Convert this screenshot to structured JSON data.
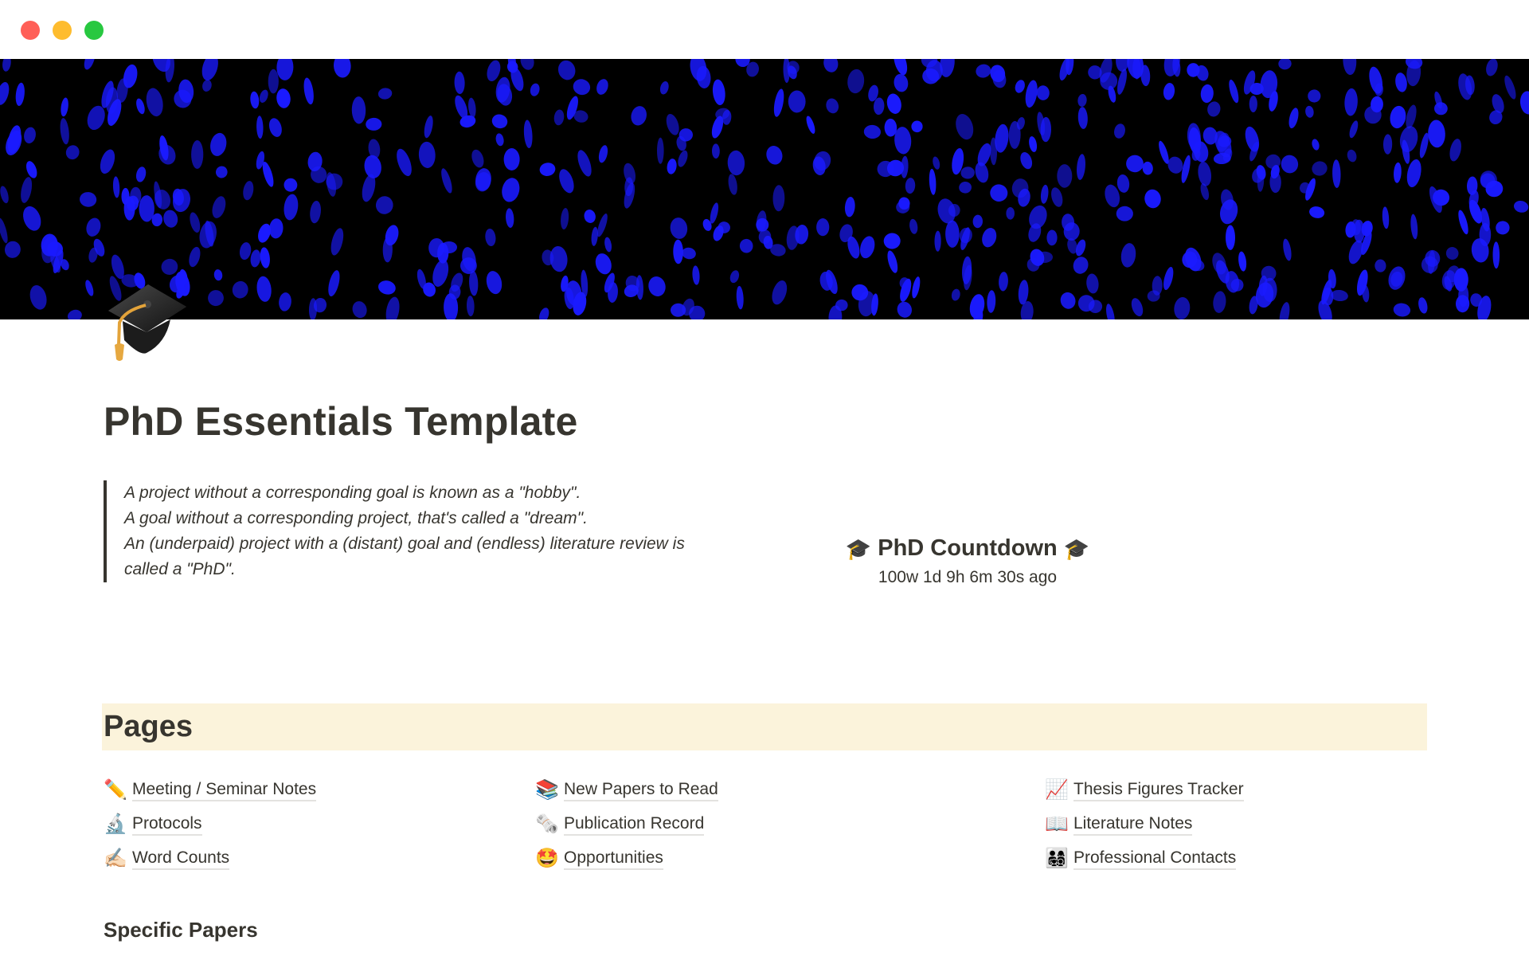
{
  "window": {
    "controls": [
      "close",
      "minimize",
      "maximize"
    ],
    "colors": {
      "close": "#ff5f57",
      "minimize": "#febc2e",
      "maximize": "#28c840"
    }
  },
  "cover": {
    "description": "blue fluorescent nuclei on black background",
    "accent": "#1a1aff"
  },
  "page": {
    "icon": "graduation-cap-icon",
    "icon_glyph": "🎓",
    "title": "PhD Essentials Template"
  },
  "quote": {
    "lines": [
      "A project without a corresponding goal is known as a \"hobby\".",
      "A goal without a corresponding project, that's called a \"dream\".",
      "An (underpaid) project with a (distant) goal and (endless) literature review is",
      "called a \"PhD\"."
    ]
  },
  "countdown": {
    "icon_glyph": "🎓",
    "title": "PhD Countdown",
    "value": "100w 1d 9h 6m 30s ago"
  },
  "pages_section": {
    "heading": "Pages",
    "background": "#fbf3db",
    "columns": [
      [
        {
          "icon": "pencil-icon",
          "glyph": "✏️",
          "label": "Meeting / Seminar Notes"
        },
        {
          "icon": "microscope-icon",
          "glyph": "🔬",
          "label": "Protocols"
        },
        {
          "icon": "writing-hand-icon",
          "glyph": "✍🏻",
          "label": "Word Counts"
        }
      ],
      [
        {
          "icon": "books-icon",
          "glyph": "📚",
          "label": "New Papers to Read"
        },
        {
          "icon": "rolled-newspaper-icon",
          "glyph": "🗞️",
          "label": "Publication Record"
        },
        {
          "icon": "star-struck-icon",
          "glyph": "🤩",
          "label": "Opportunities"
        }
      ],
      [
        {
          "icon": "chart-increasing-icon",
          "glyph": "📈",
          "label": "Thesis Figures Tracker"
        },
        {
          "icon": "open-book-icon",
          "glyph": "📖",
          "label": "Literature Notes"
        },
        {
          "icon": "family-icon",
          "glyph": "👨‍👩‍👧‍👦",
          "label": "Professional Contacts"
        }
      ]
    ]
  },
  "specific_papers": {
    "heading": "Specific Papers"
  }
}
